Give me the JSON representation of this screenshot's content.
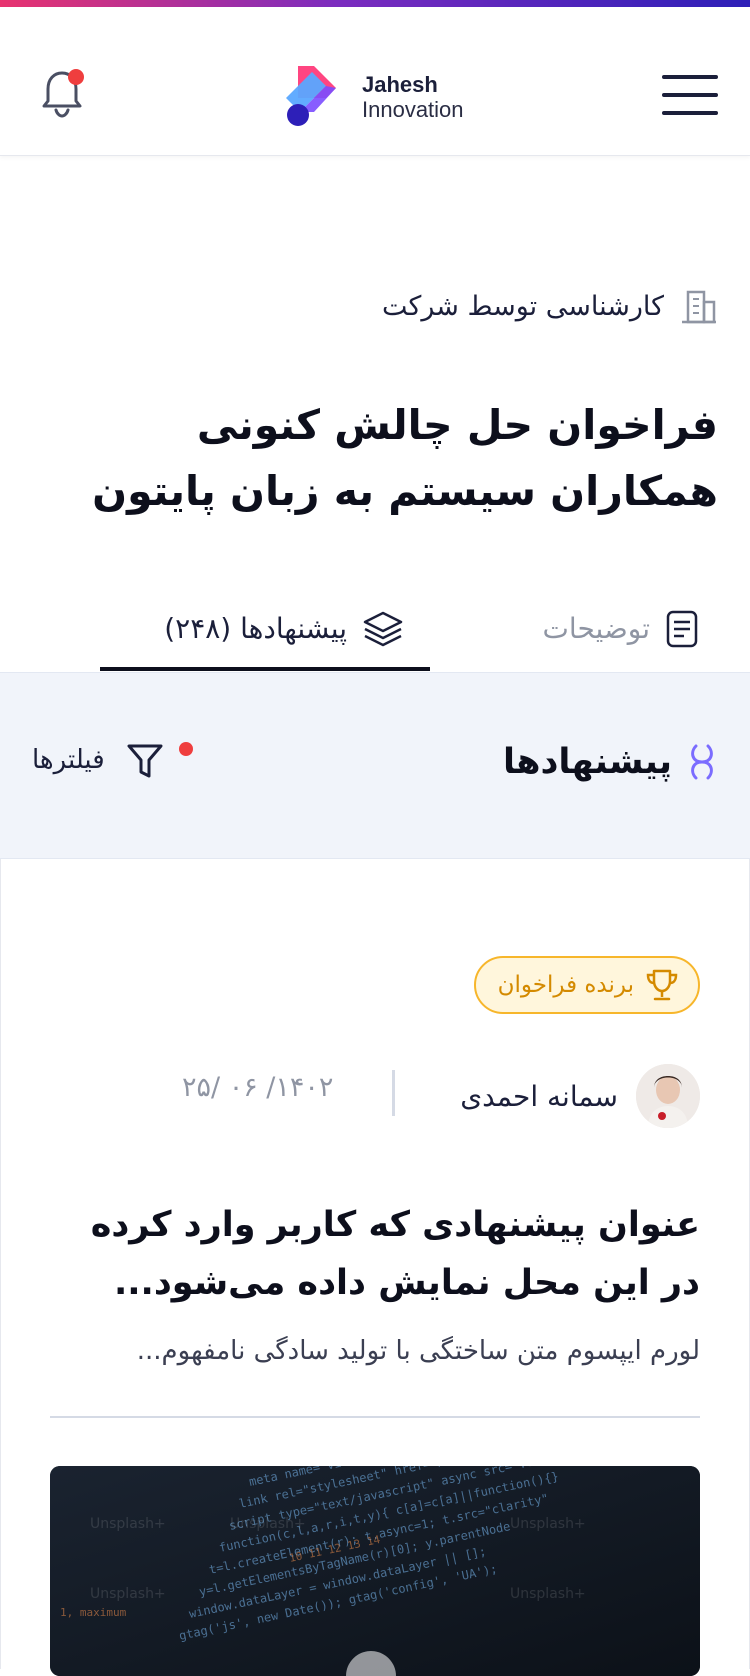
{
  "header": {
    "logo_line1": "Jahesh",
    "logo_line2": "Innovation",
    "has_notification": true
  },
  "challenge": {
    "company_label": "کارشناسی توسط شرکت",
    "title": "فراخوان حل چالش کنونی همکاران سیستم به زبان پایتون"
  },
  "tabs": [
    {
      "label": "توضیحات",
      "icon": "document-icon",
      "active": false
    },
    {
      "label": "پیشنهادها (۲۴۸)",
      "icon": "layers-icon",
      "active": true
    }
  ],
  "proposals_section": {
    "title": "پیشنهادها",
    "filters_label": "فیلترها",
    "filter_active": true
  },
  "proposal": {
    "badge": "برنده فراخوان",
    "author": "سمانه احمدی",
    "date": "۱۴۰۲/ ۰۶ /۲۵",
    "title": "عنوان پیشنهادی که کاربر وارد کرده در این محل نمایش داده می‌شود...",
    "excerpt": "لورم ایپسوم متن ساختگی با تولید سادگی نامفهوم...",
    "media_watermark": "Unsplash+"
  },
  "colors": {
    "accent_gradient": [
      "#e8336f",
      "#7b2cbf",
      "#2d1fb8"
    ],
    "notification_dot": "#ef3e3e",
    "badge_border": "#f7b62b",
    "badge_text": "#d48a00"
  }
}
